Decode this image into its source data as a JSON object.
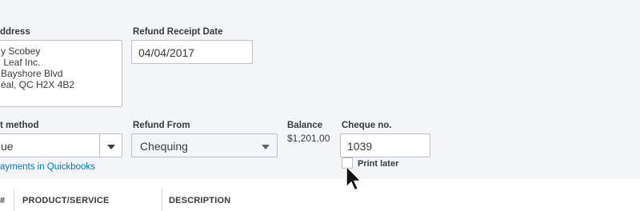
{
  "address": {
    "label": "ddress",
    "lines": [
      "y Scobey",
      " Leaf Inc.",
      "Bayshore Blvd",
      "éal, QC H2X 4B2"
    ]
  },
  "refund_receipt_date": {
    "label": "Refund Receipt Date",
    "value": "04/04/2017"
  },
  "payment_method": {
    "label": "t method",
    "value": "ue",
    "link": "ayments in Quickbooks"
  },
  "refund_from": {
    "label": "Refund From",
    "value": "Chequing"
  },
  "balance": {
    "label": "Balance",
    "value": "$1,201.00"
  },
  "cheque_no": {
    "label": "Cheque no.",
    "value": "1039"
  },
  "print_later": {
    "label": "Print later",
    "checked": false
  },
  "table": {
    "columns": [
      "#",
      "PRODUCT/SERVICE",
      "DESCRIPTION"
    ]
  },
  "colors": {
    "link": "#0077c5",
    "page_bg": "#f4f5f8",
    "border": "#babec5"
  },
  "cursor_icon": "mouse-pointer-icon"
}
